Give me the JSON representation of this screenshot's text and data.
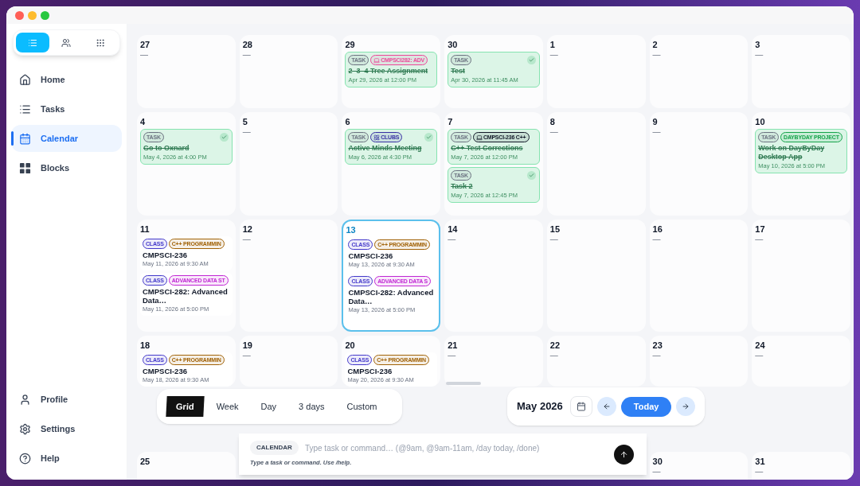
{
  "sidebar": {
    "view_switch": [
      {
        "kind": "list",
        "selected": true
      },
      {
        "kind": "people",
        "selected": false
      },
      {
        "kind": "grid",
        "selected": false
      }
    ],
    "nav_items": [
      {
        "label": "Home",
        "kind": "home",
        "selected": false
      },
      {
        "label": "Tasks",
        "kind": "tasks",
        "selected": false
      },
      {
        "label": "Calendar",
        "kind": "calendar",
        "selected": true
      },
      {
        "label": "Blocks",
        "kind": "blocks",
        "selected": false
      }
    ],
    "bottom_items": [
      {
        "label": "Profile",
        "kind": "profile"
      },
      {
        "label": "Settings",
        "kind": "settings"
      },
      {
        "label": "Help",
        "kind": "help"
      }
    ]
  },
  "calendar": {
    "weeks": [
      {
        "days": [
          {
            "day": "27",
            "today": false,
            "empty_text": "—"
          },
          {
            "day": "28",
            "today": false,
            "empty_text": "—"
          },
          {
            "day": "29",
            "today": false,
            "events": [
              {
                "kind": "task",
                "checked": false,
                "badges": [
                  {
                    "label": "TASK",
                    "color": "#6b7280"
                  },
                  {
                    "label": "CMPSCI282: ADV",
                    "color": "#ec4899",
                    "kind": "course"
                  }
                ],
                "title": "2–3–4 Tree Assignment",
                "time": "Apr 29, 2026 at 12:00 PM"
              }
            ]
          },
          {
            "day": "30",
            "today": false,
            "events": [
              {
                "kind": "task",
                "checked": true,
                "badges": [
                  {
                    "label": "TASK",
                    "color": "#6b7280"
                  }
                ],
                "title": "Test",
                "time": "Apr 30, 2026 at 11:45 AM"
              }
            ]
          },
          {
            "day": "1",
            "today": false,
            "empty_text": "—"
          },
          {
            "day": "2",
            "today": false,
            "empty_text": "—"
          },
          {
            "day": "3",
            "today": false,
            "empty_text": "—"
          }
        ]
      },
      {
        "days": [
          {
            "day": "4",
            "today": false,
            "events": [
              {
                "kind": "task",
                "checked": true,
                "badges": [
                  {
                    "label": "TASK",
                    "color": "#6b7280"
                  }
                ],
                "title": "Go to Oxnard",
                "time": "May 4, 2026 at 4:00 PM"
              }
            ]
          },
          {
            "day": "5",
            "today": false,
            "empty_text": "—"
          },
          {
            "day": "6",
            "today": false,
            "events": [
              {
                "kind": "task",
                "checked": true,
                "badges": [
                  {
                    "label": "TASK",
                    "color": "#6b7280"
                  },
                  {
                    "label": "CLUBS",
                    "color": "#3730a3",
                    "kind": "club"
                  }
                ],
                "title": "Active Minds Meeting",
                "time": "May 6, 2026 at 4:30 PM"
              }
            ]
          },
          {
            "day": "7",
            "today": false,
            "events": [
              {
                "kind": "task",
                "checked": false,
                "badges": [
                  {
                    "label": "TASK",
                    "color": "#6b7280"
                  },
                  {
                    "label": "CMPSCI-236 C++",
                    "color": "#111827",
                    "kind": "course"
                  }
                ],
                "title": "C++ Test Corrections",
                "time": "May 7, 2026 at 12:00 PM"
              },
              {
                "kind": "task",
                "checked": true,
                "badges": [
                  {
                    "label": "TASK",
                    "color": "#6b7280"
                  }
                ],
                "title": "Task 2",
                "time": "May 7, 2026 at 12:45 PM"
              }
            ]
          },
          {
            "day": "8",
            "today": false,
            "empty_text": "—"
          },
          {
            "day": "9",
            "today": false,
            "empty_text": "—"
          },
          {
            "day": "10",
            "today": false,
            "events": [
              {
                "kind": "task",
                "checked": false,
                "badges": [
                  {
                    "label": "TASK",
                    "color": "#6b7280"
                  },
                  {
                    "label": "DAYBYDAY PROJECT",
                    "color": "#16a34a"
                  }
                ],
                "title": "Work on DayByDay Desktop App",
                "time": "May 10, 2026 at 5:00 PM"
              }
            ]
          }
        ]
      },
      {
        "days": [
          {
            "day": "11",
            "today": false,
            "events": [
              {
                "kind": "class",
                "badges": [
                  {
                    "label": "CLASS",
                    "color": "#4338ca"
                  },
                  {
                    "label": "C++ PROGRAMMIN",
                    "color": "#a16207"
                  }
                ],
                "title": "CMPSCI-236",
                "time": "May 11, 2026 at 9:30 AM"
              },
              {
                "kind": "class",
                "badges": [
                  {
                    "label": "CLASS",
                    "color": "#4338ca"
                  },
                  {
                    "label": "ADVANCED DATA ST",
                    "color": "#c026d3"
                  }
                ],
                "title": "CMPSCI-282: Advanced Data…",
                "time": "May 11, 2026 at 5:00 PM"
              }
            ]
          },
          {
            "day": "12",
            "today": false,
            "empty_text": "—"
          },
          {
            "day": "13",
            "today": true,
            "events": [
              {
                "kind": "class",
                "badges": [
                  {
                    "label": "CLASS",
                    "color": "#4338ca"
                  },
                  {
                    "label": "C++ PROGRAMMIN",
                    "color": "#a16207"
                  }
                ],
                "title": "CMPSCI-236",
                "time": "May 13, 2026 at 9:30 AM"
              },
              {
                "kind": "class",
                "badges": [
                  {
                    "label": "CLASS",
                    "color": "#4338ca"
                  },
                  {
                    "label": "ADVANCED DATA S",
                    "color": "#c026d3"
                  }
                ],
                "title": "CMPSCI-282: Advanced Data…",
                "time": "May 13, 2026 at 5:00 PM"
              }
            ]
          },
          {
            "day": "14",
            "today": false,
            "empty_text": "—"
          },
          {
            "day": "15",
            "today": false,
            "empty_text": "—"
          },
          {
            "day": "16",
            "today": false,
            "empty_text": "—"
          },
          {
            "day": "17",
            "today": false,
            "empty_text": "—"
          }
        ]
      },
      {
        "days": [
          {
            "day": "18",
            "today": false,
            "events": [
              {
                "kind": "class",
                "badges": [
                  {
                    "label": "CLASS",
                    "color": "#4338ca"
                  },
                  {
                    "label": "C++ PROGRAMMIN",
                    "color": "#a16207"
                  }
                ],
                "title": "CMPSCI-236",
                "time": "May 18, 2026 at 9:30 AM"
              }
            ]
          },
          {
            "day": "19",
            "today": false,
            "empty_text": "—"
          },
          {
            "day": "20",
            "today": false,
            "events": [
              {
                "kind": "class",
                "badges": [
                  {
                    "label": "CLASS",
                    "color": "#4338ca"
                  },
                  {
                    "label": "C++ PROGRAMMIN",
                    "color": "#a16207"
                  }
                ],
                "title": "CMPSCI-236",
                "time": "May 20, 2026 at 9:30 AM"
              }
            ]
          },
          {
            "day": "21",
            "today": false,
            "empty_text": "—"
          },
          {
            "day": "22",
            "today": false,
            "empty_text": "—"
          },
          {
            "day": "23",
            "today": false,
            "empty_text": "—"
          },
          {
            "day": "24",
            "today": false,
            "empty_text": "—"
          }
        ]
      },
      {
        "days": [
          {
            "day": "25",
            "today": false
          },
          {
            "day": "30",
            "today": false,
            "empty_text": "—"
          },
          {
            "day": "31",
            "today": false,
            "empty_text": "—"
          }
        ]
      }
    ]
  },
  "view_tabs": [
    {
      "label": "Grid",
      "selected": true
    },
    {
      "label": "Week",
      "selected": false
    },
    {
      "label": "Day",
      "selected": false
    },
    {
      "label": "3 days",
      "selected": false
    },
    {
      "label": "Custom",
      "selected": false
    }
  ],
  "month_nav": {
    "title": "May 2026",
    "today_button": "Today"
  },
  "command_bar": {
    "chip": "CALENDAR",
    "placeholder": "Type task or command… (@9am, @9am-11am, /day today, /done)",
    "hint": "Type a task or command. Use /help."
  }
}
